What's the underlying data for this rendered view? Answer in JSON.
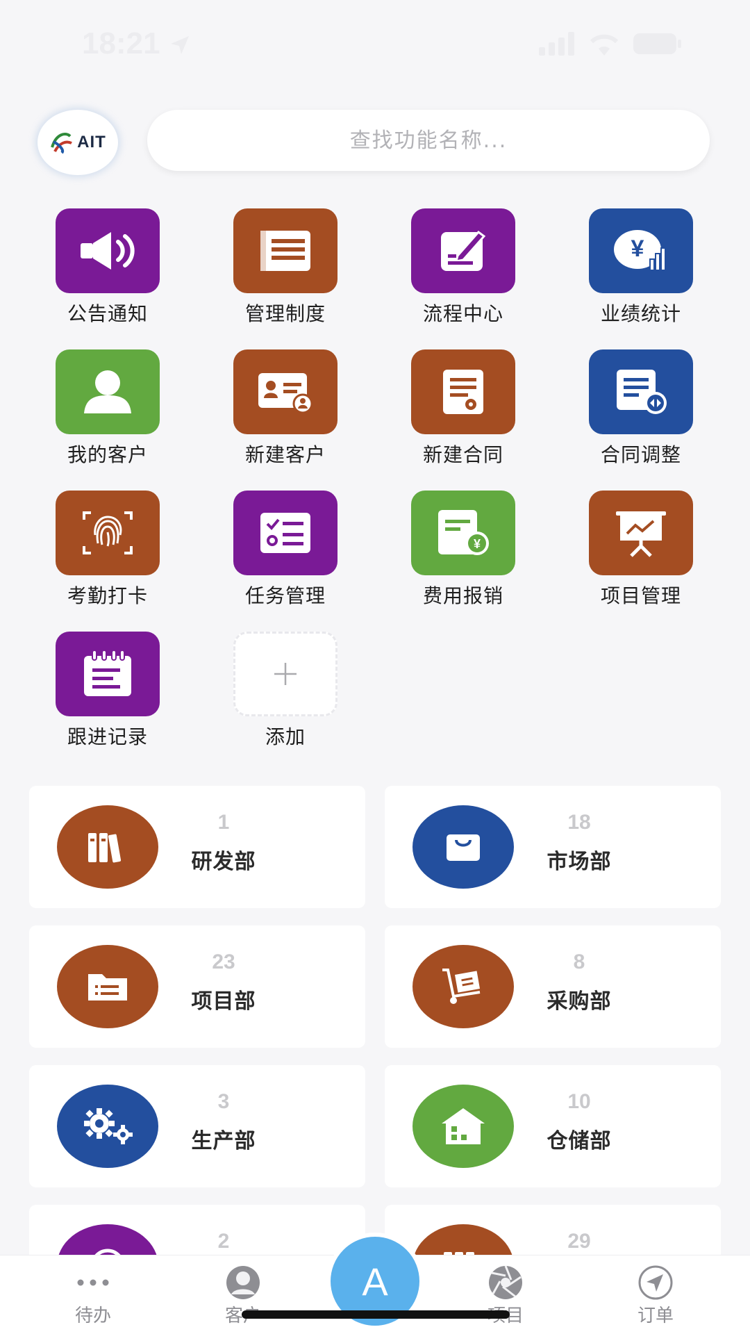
{
  "status_bar": {
    "time": "18:21"
  },
  "header": {
    "logo_text": "AIT",
    "search_placeholder": "查找功能名称..."
  },
  "apps": [
    {
      "label": "公告通知",
      "icon": "megaphone-icon",
      "color": "#7a1a96"
    },
    {
      "label": "管理制度",
      "icon": "document-list-icon",
      "color": "#a44d22"
    },
    {
      "label": "流程中心",
      "icon": "edit-note-icon",
      "color": "#7a1a96"
    },
    {
      "label": "业绩统计",
      "icon": "yen-chart-icon",
      "color": "#234f9e"
    },
    {
      "label": "我的客户",
      "icon": "user-icon",
      "color": "#62a940"
    },
    {
      "label": "新建客户",
      "icon": "id-card-icon",
      "color": "#a44d22"
    },
    {
      "label": "新建合同",
      "icon": "contract-icon",
      "color": "#a44d22"
    },
    {
      "label": "合同调整",
      "icon": "contract-adjust-icon",
      "color": "#234f9e"
    },
    {
      "label": "考勤打卡",
      "icon": "fingerprint-icon",
      "color": "#a44d22"
    },
    {
      "label": "任务管理",
      "icon": "checklist-icon",
      "color": "#7a1a96"
    },
    {
      "label": "费用报销",
      "icon": "expense-icon",
      "color": "#62a940"
    },
    {
      "label": "项目管理",
      "icon": "presentation-icon",
      "color": "#a44d22"
    },
    {
      "label": "跟进记录",
      "icon": "notepad-icon",
      "color": "#7a1a96"
    }
  ],
  "add_app": {
    "label": "添加",
    "symbol": "+"
  },
  "departments": [
    {
      "count": "1",
      "name": "研发部",
      "icon": "books-icon",
      "color": "#a44d22"
    },
    {
      "count": "18",
      "name": "市场部",
      "icon": "shopping-bag-icon",
      "color": "#234f9e"
    },
    {
      "count": "23",
      "name": "项目部",
      "icon": "folder-icon",
      "color": "#a44d22"
    },
    {
      "count": "8",
      "name": "采购部",
      "icon": "hand-truck-icon",
      "color": "#a44d22"
    },
    {
      "count": "3",
      "name": "生产部",
      "icon": "gears-icon",
      "color": "#234f9e"
    },
    {
      "count": "10",
      "name": "仓储部",
      "icon": "warehouse-icon",
      "color": "#62a940"
    },
    {
      "count": "2",
      "name": "",
      "icon": "circle-icon",
      "color": "#7a1a96"
    },
    {
      "count": "29",
      "name": "",
      "icon": "books-icon",
      "color": "#a44d22"
    }
  ],
  "tab_bar": {
    "tabs": [
      {
        "label": "待办",
        "icon": "more-dots-icon"
      },
      {
        "label": "客户",
        "icon": "person-icon"
      },
      {
        "label": "项目",
        "icon": "aperture-icon"
      },
      {
        "label": "订单",
        "icon": "navigation-icon"
      }
    ],
    "center_label": "A"
  }
}
